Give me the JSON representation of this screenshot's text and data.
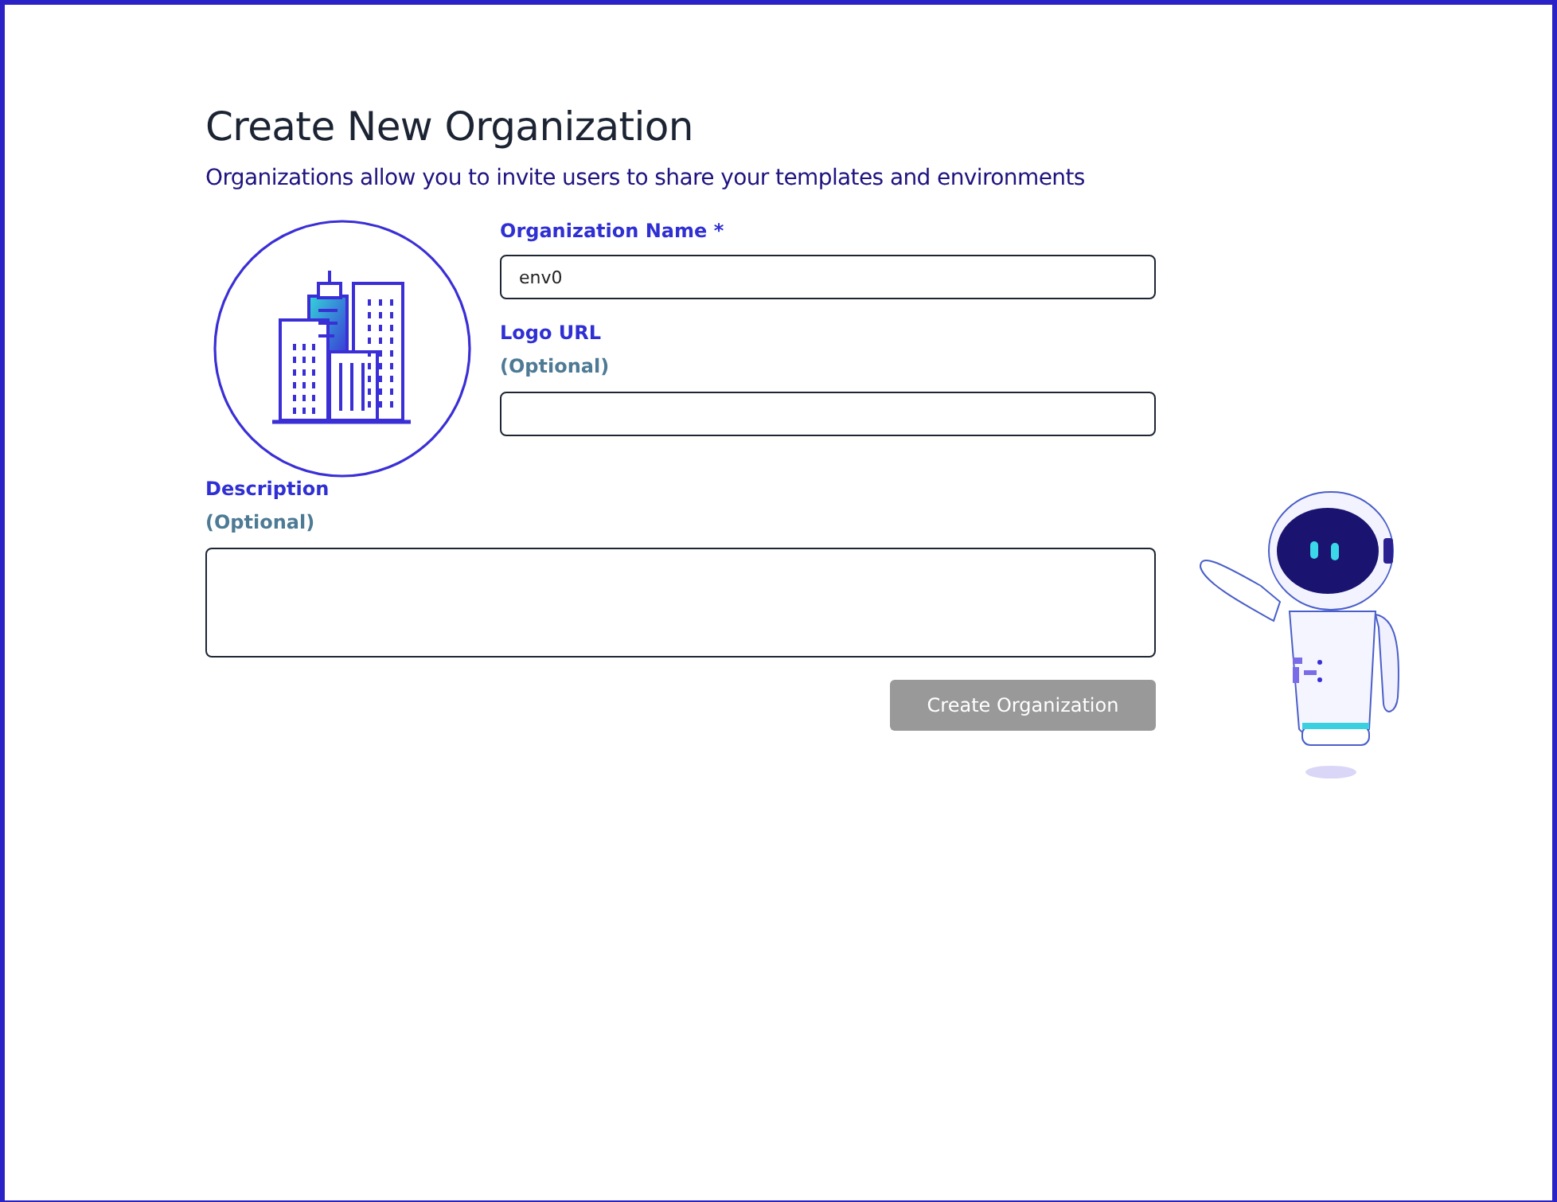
{
  "title": "Create New Organization",
  "subtitle": "Organizations allow you to invite users to share your templates and environments",
  "fields": [
    {
      "kind": "text",
      "label": "Organization Name *",
      "value": "env0"
    },
    {
      "kind": "text",
      "label": "Logo URL",
      "note": "(Optional)"
    },
    {
      "kind": "textarea",
      "label": "Description",
      "note": "(Optional)"
    }
  ],
  "button": {
    "label": "Create Organization",
    "disabled": true
  }
}
